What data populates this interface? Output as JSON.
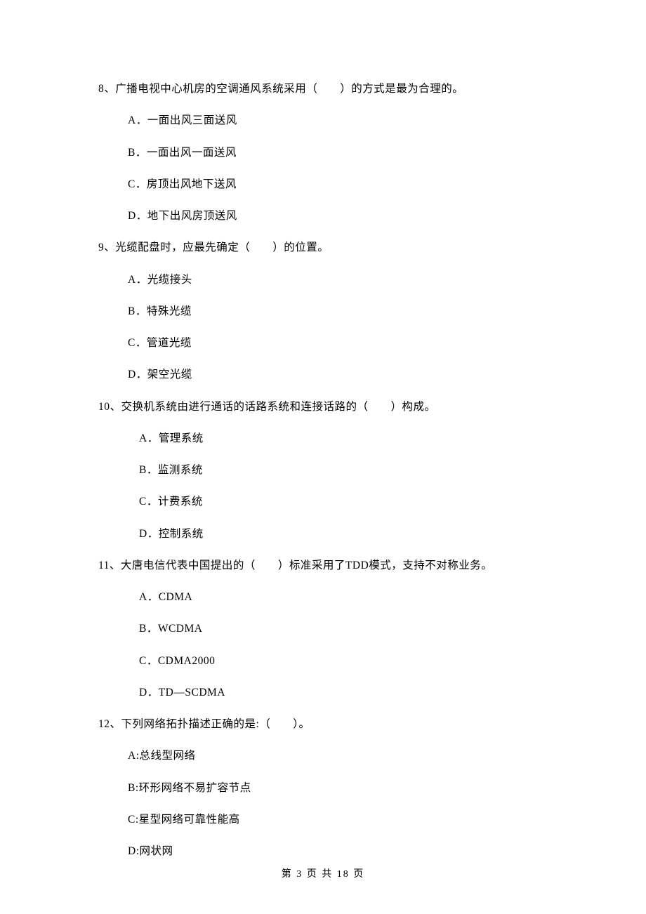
{
  "questions": [
    {
      "number": "8",
      "text": "8、广播电视中心机房的空调通风系统采用（　　）的方式是最为合理的。",
      "options": [
        "A．一面出风三面送风",
        "B．一面出风一面送风",
        "C．房顶出风地下送风",
        "D．地下出风房顶送风"
      ]
    },
    {
      "number": "9",
      "text": "9、光缆配盘时，应最先确定（　　）的位置。",
      "options": [
        "A．光缆接头",
        "B．特殊光缆",
        "C．管道光缆",
        "D．架空光缆"
      ]
    },
    {
      "number": "10",
      "text": "10、交换机系统由进行通话的话路系统和连接话路的（　　）构成。",
      "options": [
        "A．管理系统",
        "B．监测系统",
        "C．计费系统",
        "D．控制系统"
      ]
    },
    {
      "number": "11",
      "text": "11、大唐电信代表中国提出的（　　）标准采用了TDD模式，支持不对称业务。",
      "options": [
        "A．CDMA",
        "B．WCDMA",
        "C．CDMA2000",
        "D．TD—SCDMA"
      ]
    },
    {
      "number": "12",
      "text": "12、下列网络拓扑描述正确的是:（　　）。",
      "options": [
        "A:总线型网络",
        "B:环形网络不易扩容节点",
        "C:星型网络可靠性能高",
        "D:网状网"
      ]
    }
  ],
  "footer": "第 3 页 共 18 页"
}
